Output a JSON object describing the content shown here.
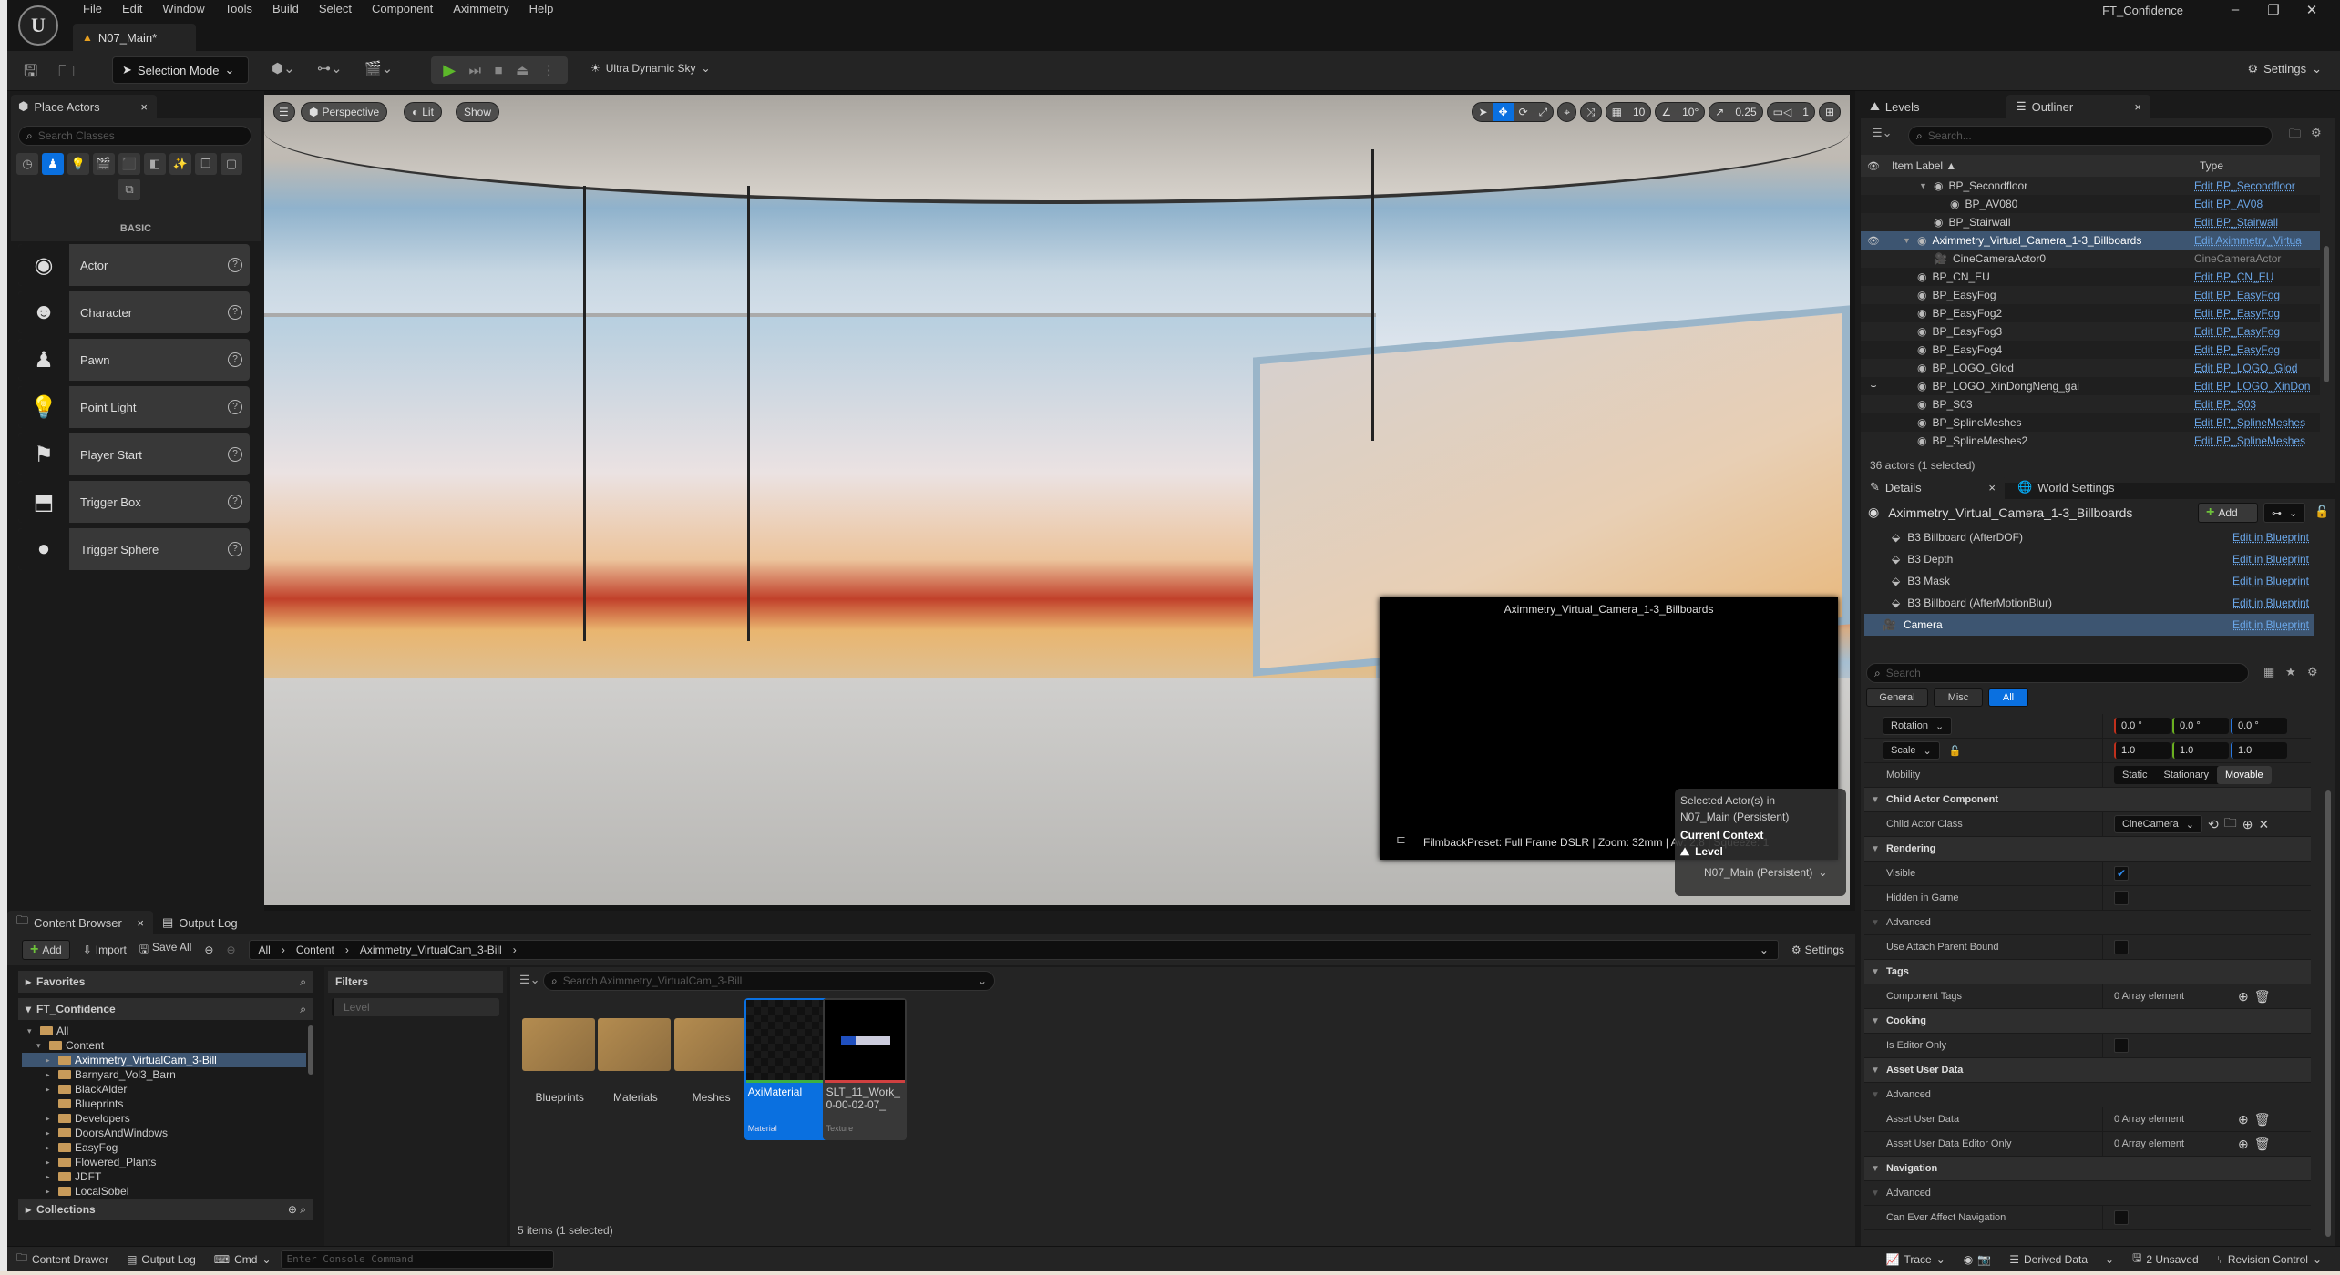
{
  "app": {
    "logo": "U",
    "project_name": "FT_Confidence",
    "doc_tab": "N07_Main*",
    "menu": [
      "File",
      "Edit",
      "Window",
      "Tools",
      "Build",
      "Select",
      "Component",
      "Aximmetry",
      "Help"
    ],
    "window_buttons": {
      "minimize": "–",
      "maximize": "❐",
      "close": "✕"
    }
  },
  "toolbar": {
    "selection_mode": "Selection Mode",
    "sky": "Ultra Dynamic Sky",
    "settings": "Settings"
  },
  "place_actors": {
    "tab": "Place Actors",
    "search_placeholder": "Search Classes",
    "category_label": "BASIC",
    "categories": [
      "recent",
      "basic",
      "lights",
      "cinematic",
      "visual-effects",
      "geometry",
      "volumes",
      "all-classes",
      "shapes",
      "more"
    ],
    "items": [
      {
        "label": "Actor",
        "icon": "◉"
      },
      {
        "label": "Character",
        "icon": "☻"
      },
      {
        "label": "Pawn",
        "icon": "♟"
      },
      {
        "label": "Point Light",
        "icon": "💡"
      },
      {
        "label": "Player Start",
        "icon": "⚑"
      },
      {
        "label": "Trigger Box",
        "icon": "⬒"
      },
      {
        "label": "Trigger Sphere",
        "icon": "●"
      }
    ]
  },
  "viewport": {
    "perspective": "Perspective",
    "lit": "Lit",
    "show": "Show",
    "grid_snap": "10",
    "rotation_snap": "10°",
    "scale_snap": "0.25",
    "camera_speed": "1",
    "camera_preview": {
      "title": "Aximmetry_Virtual_Camera_1-3_Billboards",
      "info": "FilmbackPreset: Full Frame DSLR | Zoom: 32mm | Av: 2.8 | Squeeze: 1"
    },
    "context_popup": {
      "line1": "Selected Actor(s) in",
      "line2": "N07_Main (Persistent)",
      "current_context": "Current Context",
      "level_label": "Level",
      "level_value": "N07_Main (Persistent)"
    }
  },
  "outliner": {
    "tabs": {
      "levels": "Levels",
      "outliner": "Outliner"
    },
    "search_placeholder": "Search...",
    "col_label": "Item Label ▲",
    "col_type": "Type",
    "rows": [
      {
        "label": "BP_Secondfloor",
        "type": "Edit BP_Secondfloor",
        "indent": 2,
        "expand": "▼"
      },
      {
        "label": "BP_AV080",
        "type": "Edit BP_AV08",
        "indent": 3
      },
      {
        "label": "BP_Stairwall",
        "type": "Edit BP_Stairwall",
        "indent": 2
      },
      {
        "label": "Aximmetry_Virtual_Camera_1-3_Billboards",
        "type": "Edit Aximmetry_Virtua",
        "indent": 1,
        "expand": "▼",
        "selected": true,
        "eye": "👁"
      },
      {
        "label": "CineCameraActor0",
        "type": "CineCameraActor",
        "indent": 2,
        "plain": true
      },
      {
        "label": "BP_CN_EU",
        "type": "Edit BP_CN_EU",
        "indent": 1
      },
      {
        "label": "BP_EasyFog",
        "type": "Edit BP_EasyFog",
        "indent": 1
      },
      {
        "label": "BP_EasyFog2",
        "type": "Edit BP_EasyFog",
        "indent": 1
      },
      {
        "label": "BP_EasyFog3",
        "type": "Edit BP_EasyFog",
        "indent": 1
      },
      {
        "label": "BP_EasyFog4",
        "type": "Edit BP_EasyFog",
        "indent": 1
      },
      {
        "label": "BP_LOGO_Glod",
        "type": "Edit BP_LOGO_Glod",
        "indent": 1
      },
      {
        "label": "BP_LOGO_XinDongNeng_gai",
        "type": "Edit BP_LOGO_XinDon",
        "indent": 1,
        "eye": "⌣"
      },
      {
        "label": "BP_S03",
        "type": "Edit BP_S03",
        "indent": 1
      },
      {
        "label": "BP_SplineMeshes",
        "type": "Edit BP_SplineMeshes",
        "indent": 1
      },
      {
        "label": "BP_SplineMeshes2",
        "type": "Edit BP_SplineMeshes",
        "indent": 1
      }
    ],
    "status": "36 actors (1 selected)"
  },
  "details": {
    "tabs": {
      "details": "Details",
      "world": "World Settings"
    },
    "actor_name": "Aximmetry_Virtual_Camera_1-3_Billboards",
    "add": "Add",
    "components": [
      {
        "label": "B3 Billboard (AfterDOF)",
        "link": "Edit in Blueprint"
      },
      {
        "label": "B3 Depth",
        "link": "Edit in Blueprint"
      },
      {
        "label": "B3 Mask",
        "link": "Edit in Blueprint"
      },
      {
        "label": "B3 Billboard (AfterMotionBlur)",
        "link": "Edit in Blueprint"
      },
      {
        "label": "Camera",
        "link": "Edit in Blueprint",
        "selected": true
      }
    ],
    "search_placeholder": "Search",
    "filters": [
      "General",
      "Misc",
      "All"
    ],
    "rotation": {
      "label": "Rotation",
      "x": "0.0 °",
      "y": "0.0 °",
      "z": "0.0 °"
    },
    "scale": {
      "label": "Scale",
      "x": "1.0",
      "y": "1.0",
      "z": "1.0"
    },
    "mobility": {
      "label": "Mobility",
      "options": [
        "Static",
        "Stationary",
        "Movable"
      ],
      "selected": "Movable"
    },
    "props": [
      {
        "cat": "Child Actor Component"
      },
      {
        "name": "Child Actor Class",
        "dropdown": "CineCamera"
      },
      {
        "cat": "Rendering"
      },
      {
        "name": "Visible",
        "checked": true
      },
      {
        "name": "Hidden in Game",
        "checked": false
      },
      {
        "sub": "Advanced"
      },
      {
        "name": "Use Attach Parent Bound",
        "checked": false
      },
      {
        "cat": "Tags"
      },
      {
        "name": "Component Tags",
        "array": "0 Array element"
      },
      {
        "cat": "Cooking"
      },
      {
        "name": "Is Editor Only",
        "checked": false
      },
      {
        "cat": "Asset User Data"
      },
      {
        "sub": "Advanced"
      },
      {
        "name": "Asset User Data",
        "array": "0 Array element"
      },
      {
        "name": "Asset User Data Editor Only",
        "array": "0 Array element"
      },
      {
        "cat": "Navigation"
      },
      {
        "sub": "Advanced"
      },
      {
        "name": "Can Ever Affect Navigation",
        "checked": false
      }
    ]
  },
  "content_browser": {
    "tabs": {
      "content": "Content Browser",
      "output": "Output Log"
    },
    "add": "Add",
    "import": "Import",
    "save_all": "Save All",
    "path": [
      "All",
      "Content",
      "Aximmetry_VirtualCam_3-Bill"
    ],
    "settings": "Settings",
    "favorites": "Favorites",
    "project": "FT_Confidence",
    "tree": [
      {
        "label": "All",
        "depth": 0,
        "open": true
      },
      {
        "label": "Content",
        "depth": 1,
        "open": true
      },
      {
        "label": "Aximmetry_VirtualCam_3-Bill",
        "depth": 2,
        "selected": true
      },
      {
        "label": "Barnyard_Vol3_Barn",
        "depth": 2
      },
      {
        "label": "BlackAlder",
        "depth": 2
      },
      {
        "label": "Blueprints",
        "depth": 2,
        "leaf": true
      },
      {
        "label": "Developers",
        "depth": 2
      },
      {
        "label": "DoorsAndWindows",
        "depth": 2
      },
      {
        "label": "EasyFog",
        "depth": 2
      },
      {
        "label": "Flowered_Plants",
        "depth": 2
      },
      {
        "label": "JDFT",
        "depth": 2
      },
      {
        "label": "LocalSobel",
        "depth": 2
      }
    ],
    "collections": "Collections",
    "filters_label": "Filters",
    "filter_chip": "Level",
    "search_placeholder": "Search Aximmetry_VirtualCam_3-Bill",
    "assets": [
      {
        "name": "Blueprints",
        "kind": "folder"
      },
      {
        "name": "Materials",
        "kind": "folder"
      },
      {
        "name": "Meshes",
        "kind": "folder"
      },
      {
        "name": "AxiMaterial",
        "kind": "asset",
        "type": "Material",
        "selected": true,
        "bar": "#3cb043"
      },
      {
        "name": "SLT_11_Work_0-00-02-07_",
        "kind": "asset",
        "type": "Texture",
        "bar": "#d04040"
      }
    ],
    "status": "5 items (1 selected)"
  },
  "statusbar": {
    "content_drawer": "Content Drawer",
    "output_log": "Output Log",
    "cmd": "Cmd",
    "console_placeholder": "Enter Console Command",
    "trace": "Trace",
    "derived_data": "Derived Data",
    "unsaved": "2 Unsaved",
    "revision": "Revision Control"
  }
}
